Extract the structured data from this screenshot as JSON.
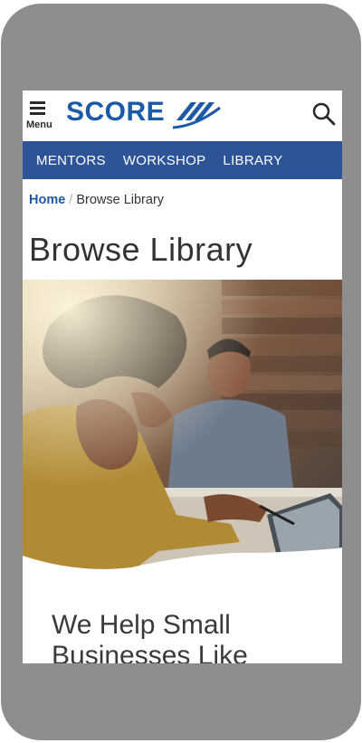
{
  "header": {
    "menu_label": "Menu",
    "logo_text": "SCORE",
    "search_icon": "search-icon"
  },
  "nav": {
    "items": [
      {
        "label": "MENTORS"
      },
      {
        "label": "WORKSHOP"
      },
      {
        "label": "LIBRARY"
      }
    ]
  },
  "breadcrumb": {
    "home": "Home",
    "separator": "/",
    "current": "Browse Library"
  },
  "page": {
    "title": "Browse Library",
    "tagline": "We Help Small Businesses Like"
  },
  "colors": {
    "brand_blue": "#1a5aa8",
    "nav_blue": "#2c5496",
    "device_gray": "#8e8e8e"
  }
}
